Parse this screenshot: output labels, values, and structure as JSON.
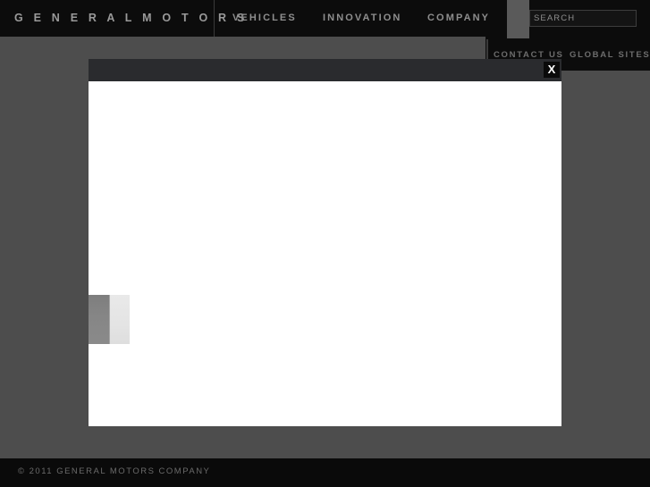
{
  "site": {
    "brand": "G E N E R A L   M O T O R S"
  },
  "main_nav": {
    "items": [
      {
        "label": "VEHICLES"
      },
      {
        "label": "INNOVATION"
      },
      {
        "label": "COMPANY"
      }
    ]
  },
  "search": {
    "placeholder": "SEARCH",
    "value": "",
    "icon": "magnifier-icon"
  },
  "utility_nav": {
    "items": [
      {
        "label": "CONTACT US"
      },
      {
        "label": "GLOBAL SITES"
      }
    ]
  },
  "modal": {
    "close_label": "X",
    "close_icon": "close-x-icon",
    "body_text": ""
  },
  "footer": {
    "copyright": "© 2011 GENERAL MOTORS COMPANY"
  },
  "colors": {
    "nav_background": "#0c0c0c",
    "page_background": "#4d4d4d",
    "modal_header": "#2a2b2e",
    "modal_body": "#ffffff",
    "footer_background": "#0a0a0a",
    "nav_text": "#8e8e8e",
    "utility_text": "#6d6d6d"
  }
}
